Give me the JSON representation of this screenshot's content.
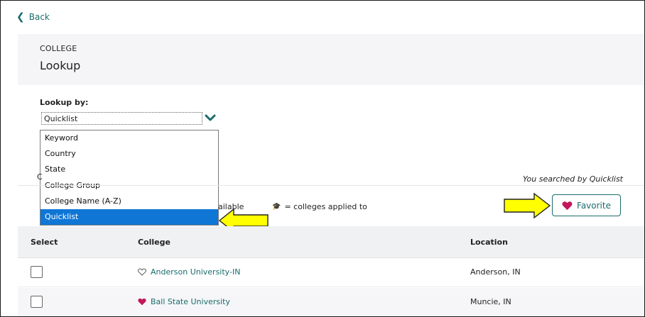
{
  "nav": {
    "back_label": "Back"
  },
  "header": {
    "eyebrow": "COLLEGE",
    "title": "Lookup"
  },
  "lookup": {
    "label": "Lookup by:",
    "selected": "Quicklist",
    "options": [
      "Keyword",
      "Country",
      "State",
      "College Group",
      "College Name (A-Z)",
      "Quicklist"
    ]
  },
  "partial_c": "C",
  "search_status": "You searched by Quicklist",
  "legend": {
    "partial": "ailable",
    "applied": "= colleges applied to"
  },
  "favorite_button": {
    "label": "Favorite"
  },
  "table": {
    "headers": {
      "select": "Select",
      "college": "College",
      "location": "Location"
    },
    "rows": [
      {
        "college": "Anderson University-IN",
        "location": "Anderson, IN",
        "favorited": false
      },
      {
        "college": "Ball State University",
        "location": "Muncie, IN",
        "favorited": true
      }
    ]
  },
  "colors": {
    "accent": "#1a6b6b",
    "heart": "#c2185b",
    "selection": "#0f76d6",
    "callout": "#ffff00"
  }
}
